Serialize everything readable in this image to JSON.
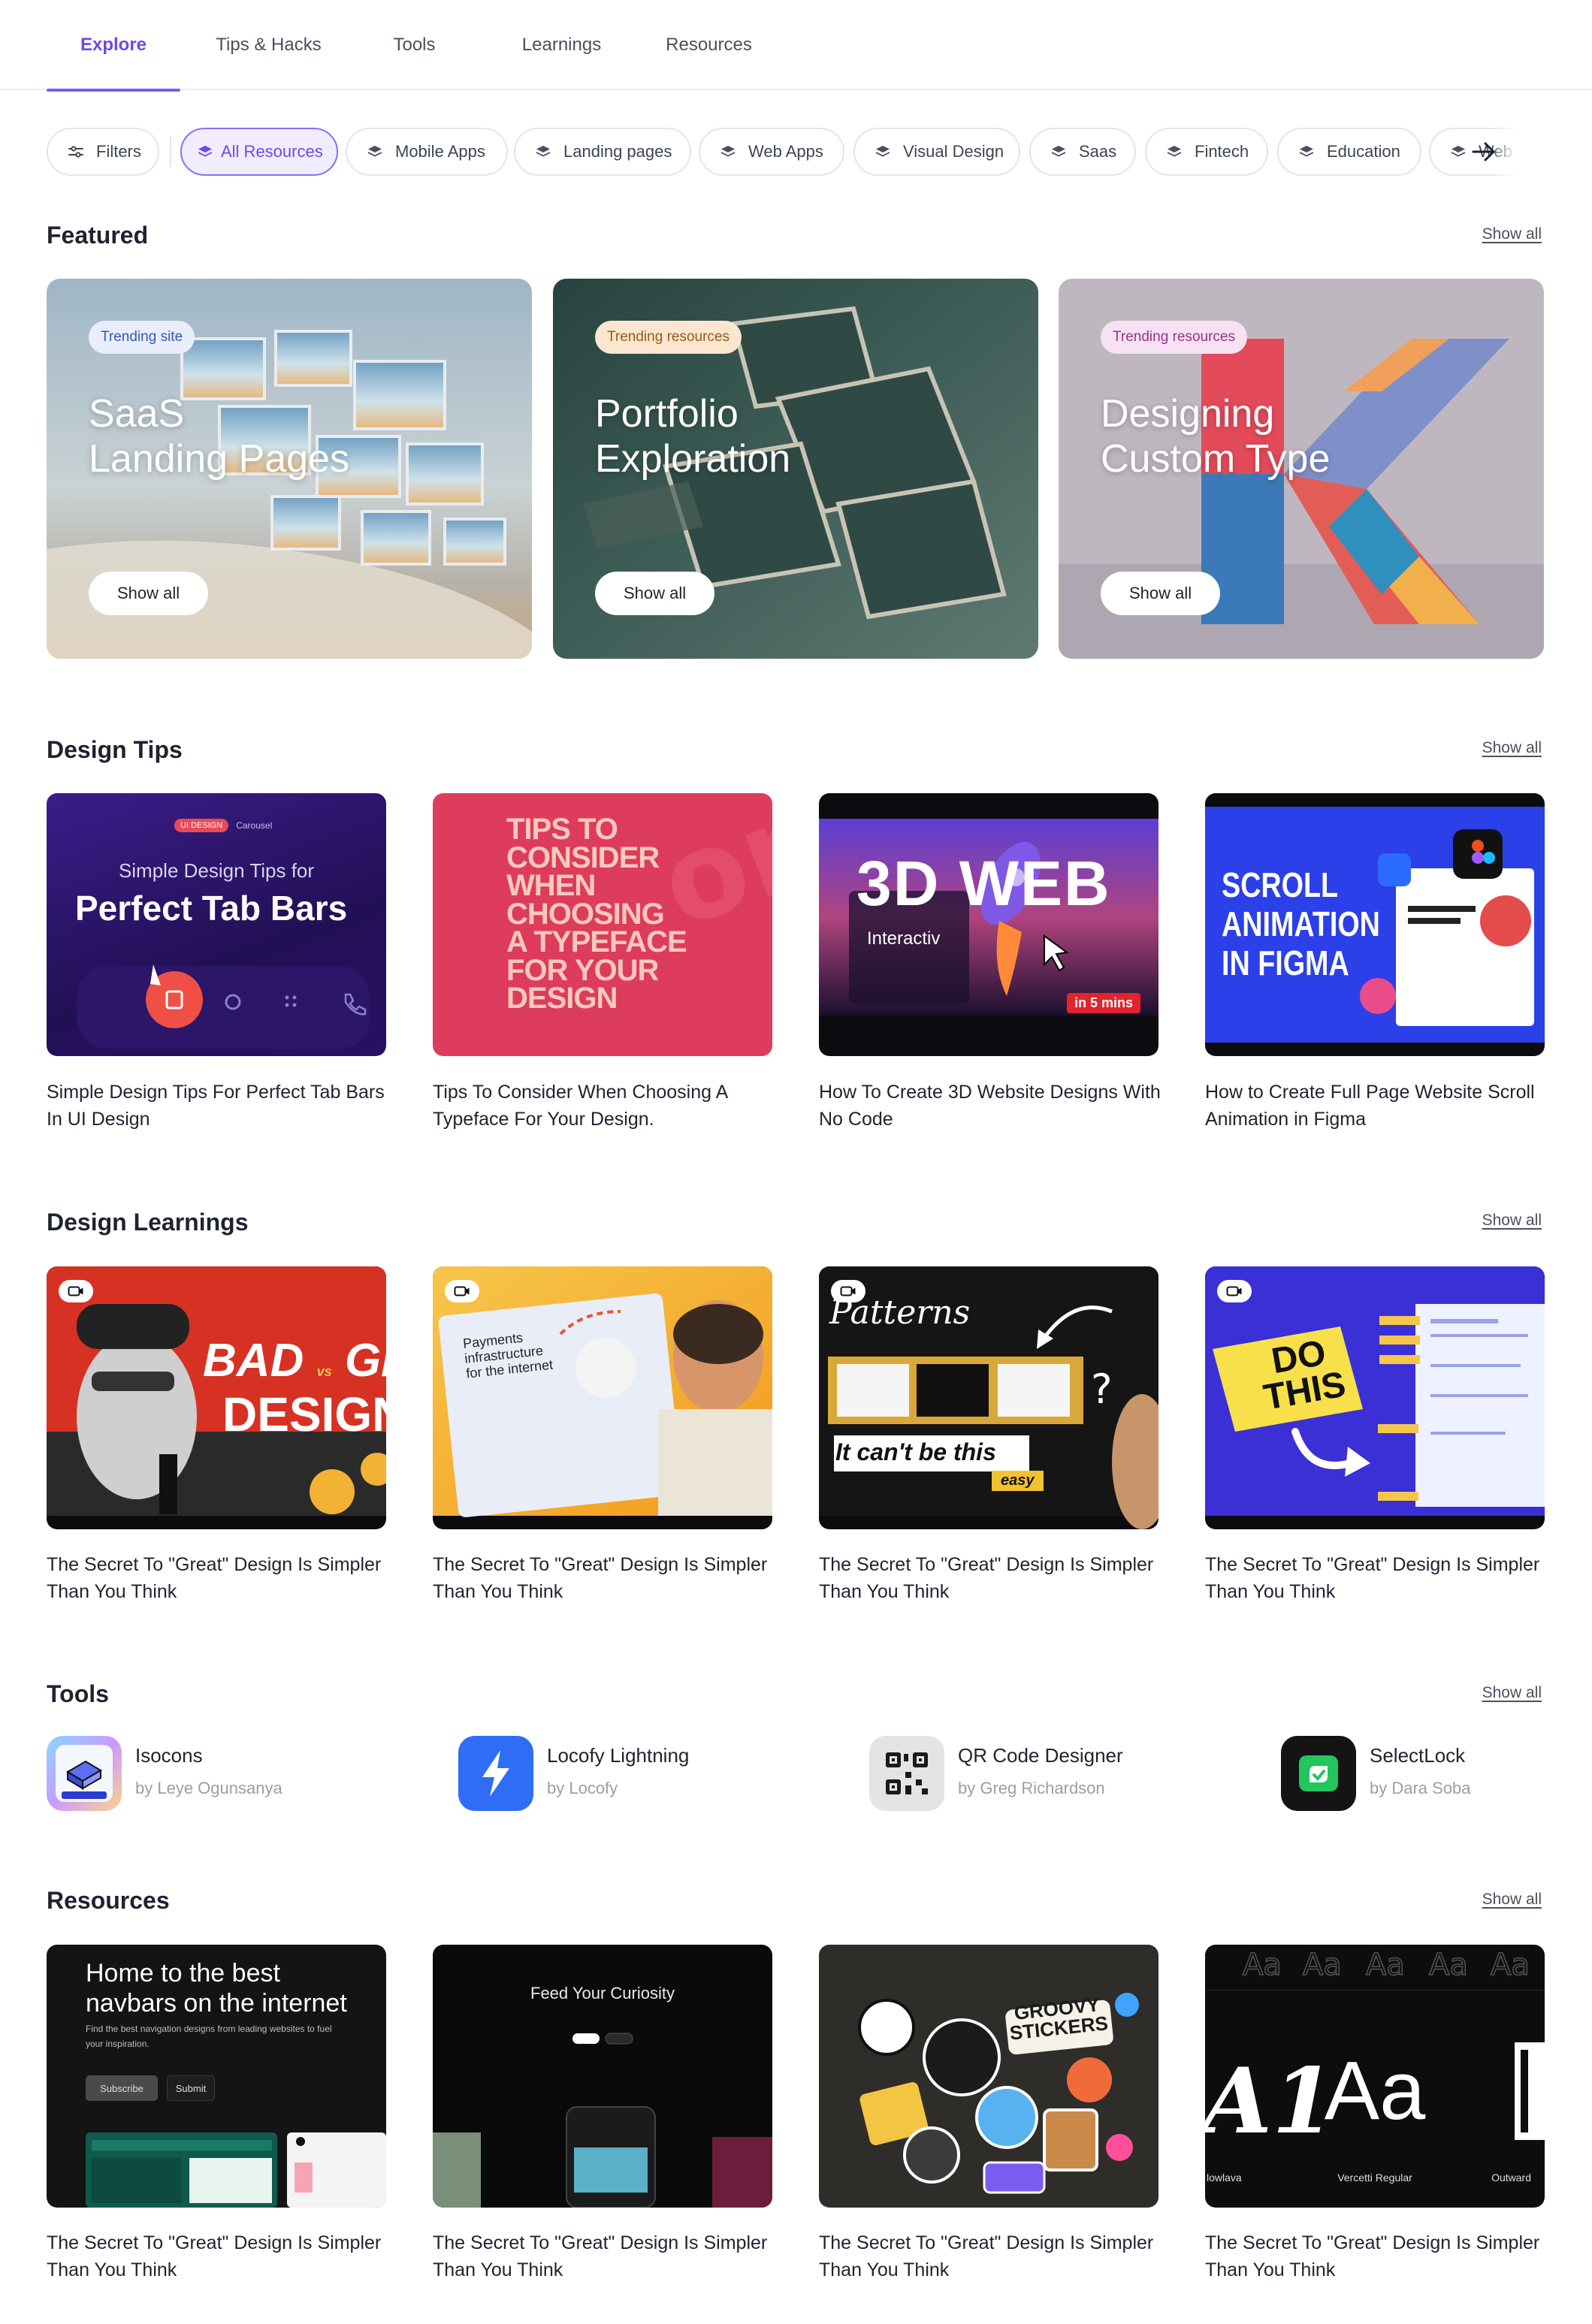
{
  "nav": {
    "tabs": [
      {
        "label": "Explore",
        "active": true
      },
      {
        "label": "Tips & Hacks",
        "active": false
      },
      {
        "label": "Tools",
        "active": false
      },
      {
        "label": "Learnings",
        "active": false
      },
      {
        "label": "Resources",
        "active": false
      }
    ]
  },
  "filters": {
    "filters_label": "Filters",
    "chips": [
      "All Resources",
      "Mobile Apps",
      "Landing pages",
      "Web Apps",
      "Visual Design",
      "Saas",
      "Fintech",
      "Education",
      "Web"
    ],
    "selected": "All Resources"
  },
  "featured": {
    "title": "Featured",
    "show_all": "Show all",
    "cards": [
      {
        "badge": "Trending site",
        "title": "SaaS\nLanding Pages",
        "button": "Show all"
      },
      {
        "badge": "Trending resources",
        "title": "Portfolio\nExploration",
        "button": "Show all"
      },
      {
        "badge": "Trending resources",
        "title": "Designing\nCustom Type",
        "button": "Show all"
      }
    ]
  },
  "design_tips": {
    "title": "Design Tips",
    "show_all": "Show all",
    "items": [
      {
        "caption": "Simple Design Tips For Perfect Tab Bars In UI Design",
        "thumb": {
          "tag": "UI DESIGN",
          "tag2": "Carousel",
          "line1": "Simple Design Tips for",
          "line2": "Perfect Tab Bars"
        }
      },
      {
        "caption": "Tips To Consider When Choosing A Typeface For Your Design.",
        "thumb": {
          "text": "TIPS TO\nCONSIDER\nWHEN\nCHOOSING\nA TYPEFACE\nFOR YOUR\nDESIGN"
        }
      },
      {
        "caption": "How To Create 3D Website Designs With No Code",
        "thumb": {
          "big": "3D WEB",
          "sub": "Interactiv",
          "tag": "in 5 mins"
        }
      },
      {
        "caption": "How to Create Full Page Website Scroll Animation in Figma",
        "thumb": {
          "text": "SCROLL\nANIMATION\nIN FIGMA"
        }
      }
    ]
  },
  "design_learnings": {
    "title": "Design Learnings",
    "show_all": "Show all",
    "items": [
      {
        "caption": "The Secret To \"Great\" Design Is Simpler Than You Think",
        "thumb": {
          "line1": "BAD",
          "vs": "vs",
          "line1b": "GRE",
          "line2": "DESIGNER"
        }
      },
      {
        "caption": "The Secret To \"Great\" Design Is Simpler Than You Think",
        "thumb": {
          "text": "Payments infrastructure for the internet"
        }
      },
      {
        "caption": "The Secret To \"Great\" Design Is Simpler Than You Think",
        "thumb": {
          "title": "Patterns",
          "text": "It can't be this",
          "tag": "easy"
        }
      },
      {
        "caption": "The Secret To \"Great\" Design Is Simpler Than You Think",
        "thumb": {
          "text": "DO\nTHIS"
        }
      }
    ]
  },
  "tools": {
    "title": "Tools",
    "show_all": "Show all",
    "items": [
      {
        "name": "Isocons",
        "by": "by Leye Ogunsanya",
        "icon": "isocons-icon"
      },
      {
        "name": "Locofy Lightning",
        "by": "by Locofy",
        "icon": "lightning-icon"
      },
      {
        "name": "QR Code Designer",
        "by": "by Greg Richardson",
        "icon": "qr-code-icon"
      },
      {
        "name": "SelectLock",
        "by": "by Dara Soba",
        "icon": "selectlock-icon"
      }
    ]
  },
  "resources": {
    "title": "Resources",
    "show_all": "Show all",
    "items": [
      {
        "caption": "The Secret To \"Great\" Design Is Simpler Than You Think",
        "thumb": {
          "line1": "Home to the best",
          "line2": "navbars on the internet",
          "sub": "Find the best navigation designs from leading websites to fuel your inspiration.",
          "btn1": "Subscribe",
          "btn2": "Submit"
        }
      },
      {
        "caption": "The Secret To \"Great\" Design Is Simpler Than You Think",
        "thumb": {
          "title": "Feed Your Curiosity"
        }
      },
      {
        "caption": "The Secret To \"Great\" Design Is Simpler Than You Think",
        "thumb": {
          "title": "GROOVY STICKERS"
        }
      },
      {
        "caption": "The Secret To \"Great\" Design Is Simpler Than You Think",
        "thumb": {
          "glyph": "Aa",
          "left": "lowlava",
          "mid": "Vercetti Regular",
          "right": "Outward"
        }
      }
    ]
  },
  "colors": {
    "accent": "#7c5cf0",
    "accent_text": "#6d4ae6",
    "text": "#1f2330",
    "muted": "#9a9eaa"
  }
}
